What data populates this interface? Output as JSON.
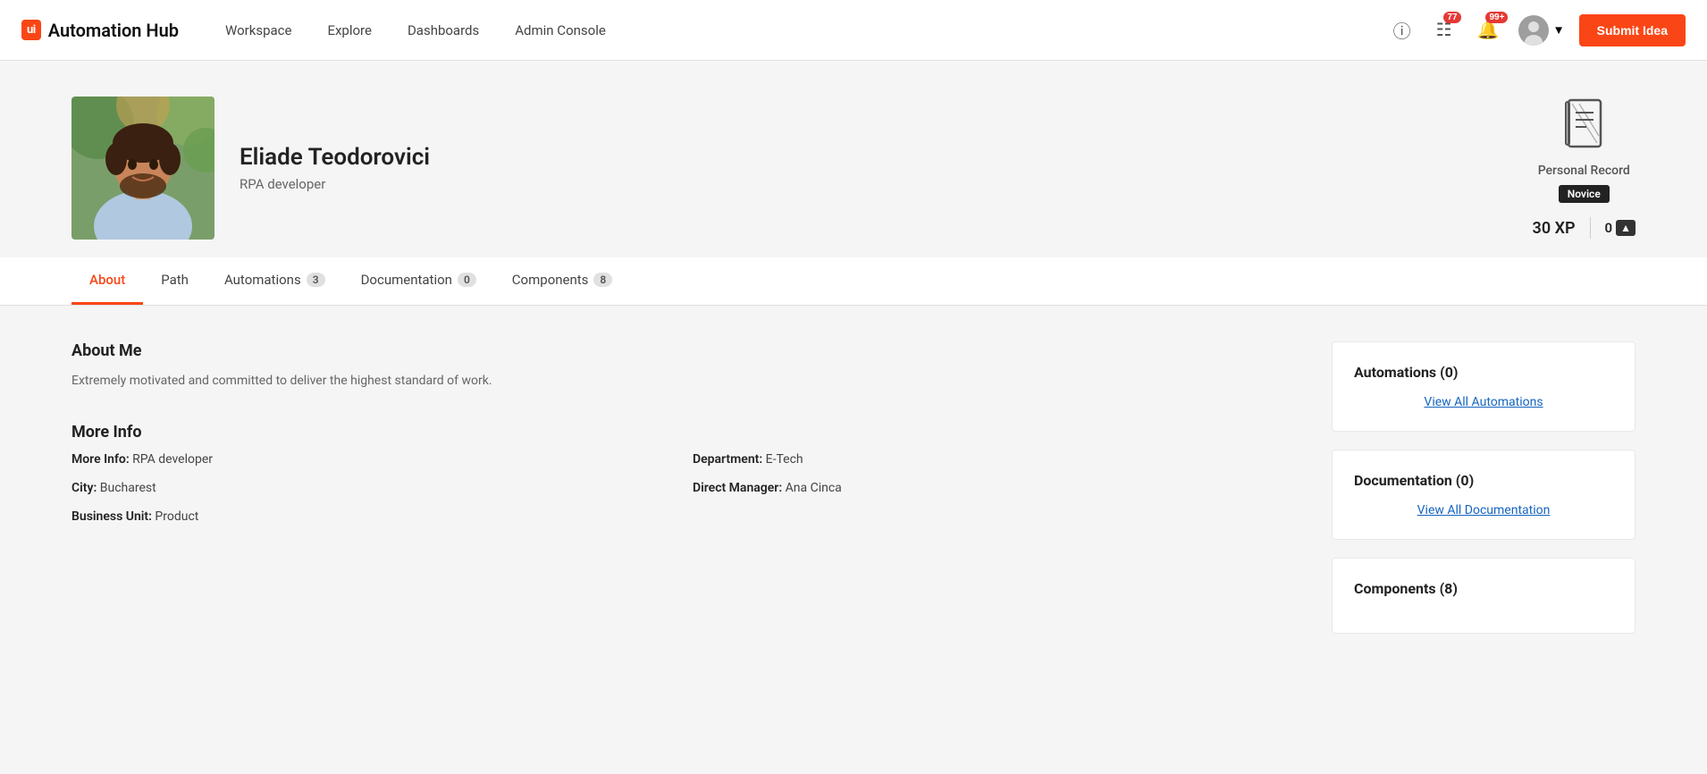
{
  "app": {
    "logo_text": "Automation Hub",
    "logo_icon": "ui"
  },
  "navbar": {
    "items": [
      {
        "label": "Workspace",
        "id": "workspace"
      },
      {
        "label": "Explore",
        "id": "explore"
      },
      {
        "label": "Dashboards",
        "id": "dashboards"
      },
      {
        "label": "Admin Console",
        "id": "admin-console"
      }
    ],
    "notifications_count": "77",
    "alerts_count": "99+",
    "submit_label": "Submit Idea"
  },
  "profile": {
    "name": "Eliade Teodorovici",
    "role": "RPA developer",
    "personal_record_label": "Personal Record",
    "level_badge": "Novice",
    "xp": "30 XP",
    "coins": "0"
  },
  "tabs": [
    {
      "label": "About",
      "id": "about",
      "count": null,
      "active": true
    },
    {
      "label": "Path",
      "id": "path",
      "count": null,
      "active": false
    },
    {
      "label": "Automations",
      "id": "automations",
      "count": "3",
      "active": false
    },
    {
      "label": "Documentation",
      "id": "documentation",
      "count": "0",
      "active": false
    },
    {
      "label": "Components",
      "id": "components",
      "count": "8",
      "active": false
    }
  ],
  "about": {
    "section_title": "About Me",
    "bio": "Extremely motivated and committed to deliver the highest standard of work.",
    "more_info_title": "More Info",
    "fields": [
      {
        "label": "More Info:",
        "value": "RPA developer"
      },
      {
        "label": "Department:",
        "value": "E-Tech"
      },
      {
        "label": "City:",
        "value": "Bucharest"
      },
      {
        "label": "Direct Manager:",
        "value": "Ana Cinca"
      },
      {
        "label": "Business Unit:",
        "value": "Product"
      }
    ]
  },
  "sidebar": {
    "automations": {
      "title": "Automations (0)",
      "view_all": "View All Automations"
    },
    "documentation": {
      "title": "Documentation (0)",
      "view_all": "View All Documentation"
    },
    "components": {
      "title": "Components (8)"
    }
  }
}
